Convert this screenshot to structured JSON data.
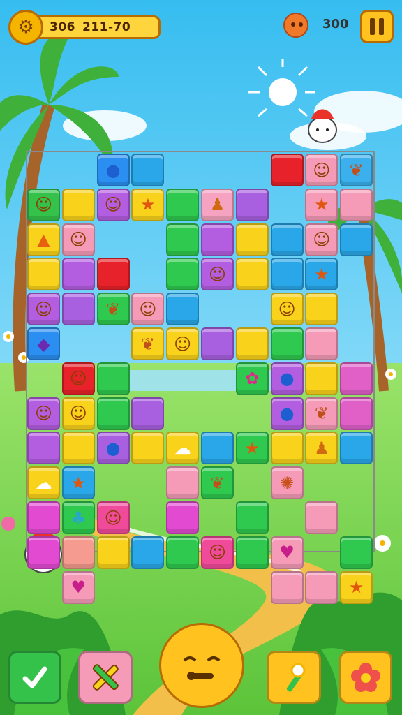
{
  "hud": {
    "coin_icon": "gear-coin-icon",
    "moves_value": "306",
    "score_value": "211-70",
    "lives_icon": "face-icon",
    "lives_value": "300",
    "pause_icon": "pause-icon"
  },
  "board": {
    "tiles": [
      {
        "col": 2,
        "row": 0,
        "color": "#2a8ff0",
        "icon": "orb"
      },
      {
        "col": 3,
        "row": 0,
        "color": "#29a7e8",
        "icon": ""
      },
      {
        "col": 7,
        "row": 0,
        "color": "#e8222a",
        "icon": ""
      },
      {
        "col": 8,
        "row": 0,
        "color": "#f59bb8",
        "icon": "face"
      },
      {
        "col": 9,
        "row": 0,
        "color": "#3bb0ec",
        "icon": "leaf"
      },
      {
        "col": 0,
        "row": 1,
        "color": "#35c24a",
        "icon": "face"
      },
      {
        "col": 1,
        "row": 1,
        "color": "#f9d21c",
        "icon": ""
      },
      {
        "col": 2,
        "row": 1,
        "color": "#b35ee0",
        "icon": "face"
      },
      {
        "col": 3,
        "row": 1,
        "color": "#f9d21c",
        "icon": "star"
      },
      {
        "col": 4,
        "row": 1,
        "color": "#2fc94f",
        "icon": ""
      },
      {
        "col": 5,
        "row": 1,
        "color": "#f5a3c0",
        "icon": "figure"
      },
      {
        "col": 6,
        "row": 1,
        "color": "#a860e0",
        "icon": ""
      },
      {
        "col": 8,
        "row": 1,
        "color": "#f59bb8",
        "icon": "star"
      },
      {
        "col": 9,
        "row": 1,
        "color": "#f59bb8",
        "icon": ""
      },
      {
        "col": 0,
        "row": 2,
        "color": "#f9d21c",
        "icon": "carrot"
      },
      {
        "col": 1,
        "row": 2,
        "color": "#f59bb8",
        "icon": "face"
      },
      {
        "col": 4,
        "row": 2,
        "color": "#2fc94f",
        "icon": ""
      },
      {
        "col": 5,
        "row": 2,
        "color": "#b35ee0",
        "icon": ""
      },
      {
        "col": 6,
        "row": 2,
        "color": "#f9d21c",
        "icon": ""
      },
      {
        "col": 7,
        "row": 2,
        "color": "#29a7e8",
        "icon": ""
      },
      {
        "col": 8,
        "row": 2,
        "color": "#f59bb8",
        "icon": "face"
      },
      {
        "col": 9,
        "row": 2,
        "color": "#29a7e8",
        "icon": ""
      },
      {
        "col": 0,
        "row": 3,
        "color": "#f9d21c",
        "icon": ""
      },
      {
        "col": 1,
        "row": 3,
        "color": "#b35ee0",
        "icon": ""
      },
      {
        "col": 2,
        "row": 3,
        "color": "#e8222a",
        "icon": ""
      },
      {
        "col": 4,
        "row": 3,
        "color": "#2fc94f",
        "icon": ""
      },
      {
        "col": 5,
        "row": 3,
        "color": "#b35ee0",
        "icon": "face"
      },
      {
        "col": 6,
        "row": 3,
        "color": "#f9d21c",
        "icon": ""
      },
      {
        "col": 7,
        "row": 3,
        "color": "#29a7e8",
        "icon": ""
      },
      {
        "col": 8,
        "row": 3,
        "color": "#29a7e8",
        "icon": "star"
      },
      {
        "col": 0,
        "row": 4,
        "color": "#b35ee0",
        "icon": "face"
      },
      {
        "col": 1,
        "row": 4,
        "color": "#a860e0",
        "icon": ""
      },
      {
        "col": 2,
        "row": 4,
        "color": "#2fc94f",
        "icon": "leaf"
      },
      {
        "col": 3,
        "row": 4,
        "color": "#f59bb8",
        "icon": "face"
      },
      {
        "col": 4,
        "row": 4,
        "color": "#29a7e8",
        "icon": ""
      },
      {
        "col": 7,
        "row": 4,
        "color": "#f9d21c",
        "icon": "face"
      },
      {
        "col": 8,
        "row": 4,
        "color": "#f9d21c",
        "icon": ""
      },
      {
        "col": 0,
        "row": 5,
        "color": "#2a8ff0",
        "icon": "gem"
      },
      {
        "col": 3,
        "row": 5,
        "color": "#f9d21c",
        "icon": "leaf"
      },
      {
        "col": 4,
        "row": 5,
        "color": "#f9d21c",
        "icon": "face"
      },
      {
        "col": 5,
        "row": 5,
        "color": "#a860e0",
        "icon": ""
      },
      {
        "col": 6,
        "row": 5,
        "color": "#f9d21c",
        "icon": ""
      },
      {
        "col": 7,
        "row": 5,
        "color": "#2fc94f",
        "icon": ""
      },
      {
        "col": 8,
        "row": 5,
        "color": "#f59bb8",
        "icon": ""
      },
      {
        "col": 1,
        "row": 6,
        "color": "#e8222a",
        "icon": "face"
      },
      {
        "col": 2,
        "row": 6,
        "color": "#2fc94f",
        "icon": ""
      },
      {
        "col": 6,
        "row": 6,
        "color": "#2fc94f",
        "icon": "flower"
      },
      {
        "col": 7,
        "row": 6,
        "color": "#b35ee0",
        "icon": "orb"
      },
      {
        "col": 8,
        "row": 6,
        "color": "#f9d21c",
        "icon": ""
      },
      {
        "col": 9,
        "row": 6,
        "color": "#e060c8",
        "icon": ""
      },
      {
        "col": 0,
        "row": 7,
        "color": "#b35ee0",
        "icon": "face"
      },
      {
        "col": 1,
        "row": 7,
        "color": "#f9d21c",
        "icon": "face"
      },
      {
        "col": 2,
        "row": 7,
        "color": "#2fc94f",
        "icon": ""
      },
      {
        "col": 3,
        "row": 7,
        "color": "#a860e0",
        "icon": ""
      },
      {
        "col": 7,
        "row": 7,
        "color": "#b35ee0",
        "icon": "orb"
      },
      {
        "col": 8,
        "row": 7,
        "color": "#f59bb8",
        "icon": "leaf"
      },
      {
        "col": 9,
        "row": 7,
        "color": "#e060c8",
        "icon": ""
      },
      {
        "col": 0,
        "row": 8,
        "color": "#b35ee0",
        "icon": ""
      },
      {
        "col": 1,
        "row": 8,
        "color": "#f9d21c",
        "icon": ""
      },
      {
        "col": 2,
        "row": 8,
        "color": "#a860e0",
        "icon": "orb"
      },
      {
        "col": 3,
        "row": 8,
        "color": "#f9d21c",
        "icon": ""
      },
      {
        "col": 4,
        "row": 8,
        "color": "#f9d21c",
        "icon": "ghost"
      },
      {
        "col": 5,
        "row": 8,
        "color": "#29a7e8",
        "icon": ""
      },
      {
        "col": 6,
        "row": 8,
        "color": "#2fc94f",
        "icon": "star"
      },
      {
        "col": 7,
        "row": 8,
        "color": "#f9d21c",
        "icon": ""
      },
      {
        "col": 8,
        "row": 8,
        "color": "#f9d21c",
        "icon": "figure"
      },
      {
        "col": 9,
        "row": 8,
        "color": "#29a7e8",
        "icon": ""
      },
      {
        "col": 0,
        "row": 9,
        "color": "#f9d21c",
        "icon": "ghost"
      },
      {
        "col": 1,
        "row": 9,
        "color": "#29a7e8",
        "icon": "star"
      },
      {
        "col": 4,
        "row": 9,
        "color": "#f59bb8",
        "icon": ""
      },
      {
        "col": 5,
        "row": 9,
        "color": "#2fc94f",
        "icon": "leaf"
      },
      {
        "col": 7,
        "row": 9,
        "color": "#f59bb8",
        "icon": "shell"
      },
      {
        "col": 0,
        "row": 10,
        "color": "#e24ad2",
        "icon": ""
      },
      {
        "col": 1,
        "row": 10,
        "color": "#2fc94f",
        "icon": "hat"
      },
      {
        "col": 2,
        "row": 10,
        "color": "#f04a9a",
        "icon": "face"
      },
      {
        "col": 4,
        "row": 10,
        "color": "#e24ad2",
        "icon": ""
      },
      {
        "col": 6,
        "row": 10,
        "color": "#2fc94f",
        "icon": ""
      },
      {
        "col": 8,
        "row": 10,
        "color": "#f59bb8",
        "icon": ""
      },
      {
        "col": 0,
        "row": 11,
        "color": "#e24ad2",
        "icon": ""
      },
      {
        "col": 1,
        "row": 11,
        "color": "#f59b8f",
        "icon": ""
      },
      {
        "col": 2,
        "row": 11,
        "color": "#f9d21c",
        "icon": ""
      },
      {
        "col": 3,
        "row": 11,
        "color": "#29a7e8",
        "icon": ""
      },
      {
        "col": 4,
        "row": 11,
        "color": "#2fc94f",
        "icon": ""
      },
      {
        "col": 5,
        "row": 11,
        "color": "#f04a9a",
        "icon": "face"
      },
      {
        "col": 6,
        "row": 11,
        "color": "#2fc94f",
        "icon": ""
      },
      {
        "col": 7,
        "row": 11,
        "color": "#f59bb8",
        "icon": "heart"
      },
      {
        "col": 9,
        "row": 11,
        "color": "#2fc94f",
        "icon": ""
      },
      {
        "col": 1,
        "row": 12,
        "color": "#f59bb8",
        "icon": "heart"
      },
      {
        "col": 7,
        "row": 12,
        "color": "#f59bb8",
        "icon": ""
      },
      {
        "col": 8,
        "row": 12,
        "color": "#f59bb8",
        "icon": ""
      },
      {
        "col": 9,
        "row": 12,
        "color": "#f9d21c",
        "icon": "star"
      }
    ]
  },
  "controls": {
    "confirm_icon": "checkmark-icon",
    "tools_icon": "cross-tools-icon",
    "mascot_icon": "sleepy-face-icon",
    "brush_icon": "flower-brush-icon",
    "flower_icon": "flower-icon"
  },
  "colors": {
    "sky_top": "#3fc4f0",
    "sky_bottom": "#b8ecff",
    "grass": "#7ed957",
    "hud_gold": "#ffd53d"
  }
}
